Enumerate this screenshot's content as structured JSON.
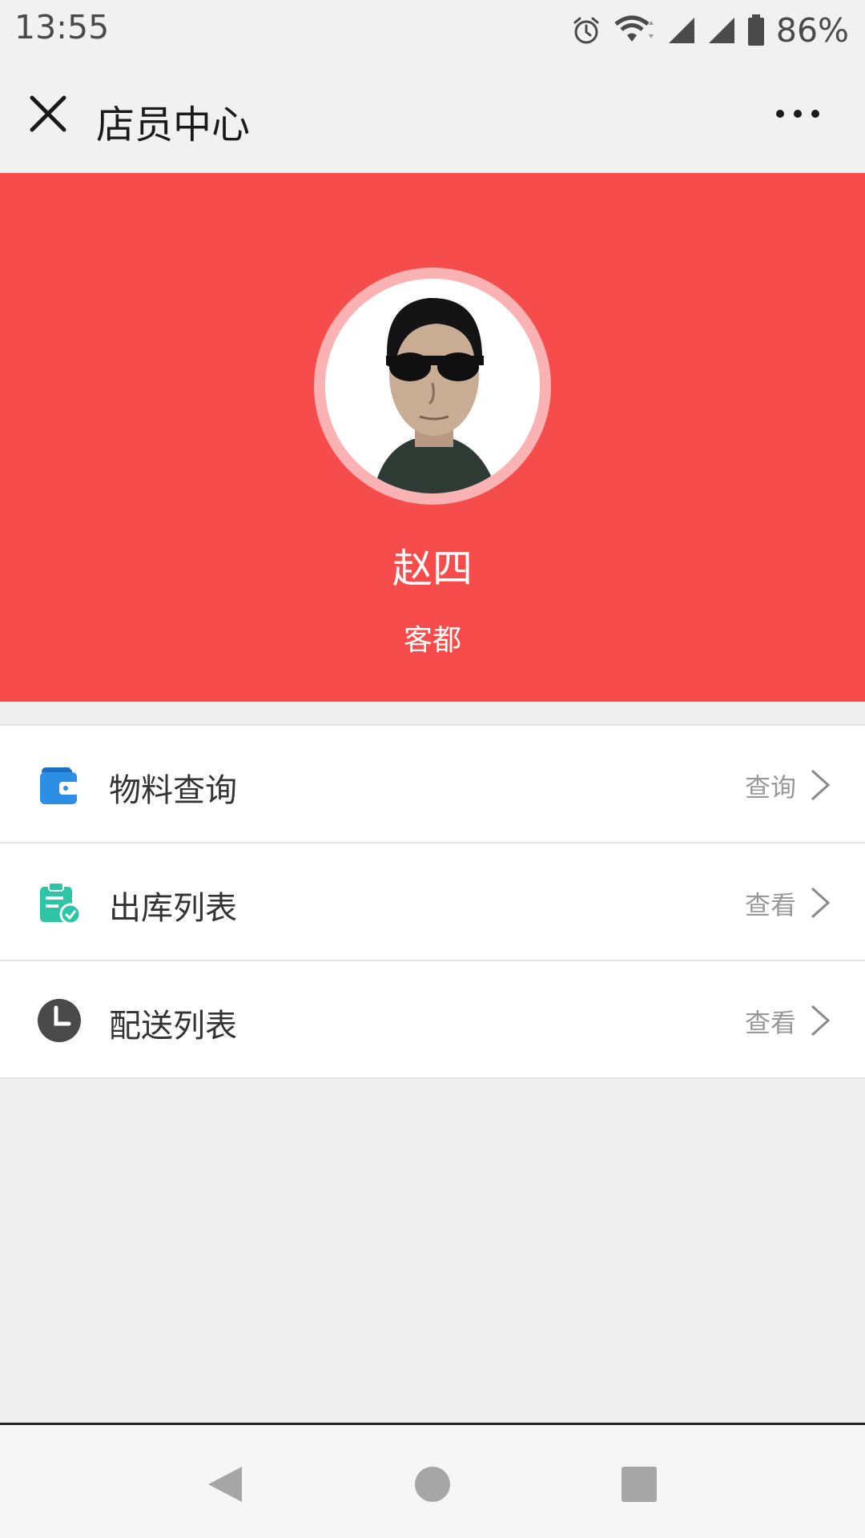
{
  "status_bar": {
    "time": "13:55",
    "battery": "86%",
    "icons": [
      "alarm-icon",
      "wifi-icon",
      "signal-icon",
      "signal-icon",
      "battery-icon"
    ]
  },
  "title_bar": {
    "title": "店员中心",
    "close_icon": "close-icon",
    "more_icon": "more-icon"
  },
  "profile": {
    "name": "赵四",
    "org": "客都",
    "header_color": "#f74c4c"
  },
  "menu": {
    "items": [
      {
        "label": "物料查询",
        "action": "查询",
        "icon": "wallet-icon",
        "icon_color": "#2d8ee6"
      },
      {
        "label": "出库列表",
        "action": "查看",
        "icon": "clipboard-check-icon",
        "icon_color": "#2ec4a6"
      },
      {
        "label": "配送列表",
        "action": "查看",
        "icon": "clock-icon",
        "icon_color": "#4a4a4a"
      }
    ]
  },
  "nav_bar": {
    "buttons": [
      "back-icon",
      "home-icon",
      "recents-icon"
    ]
  }
}
